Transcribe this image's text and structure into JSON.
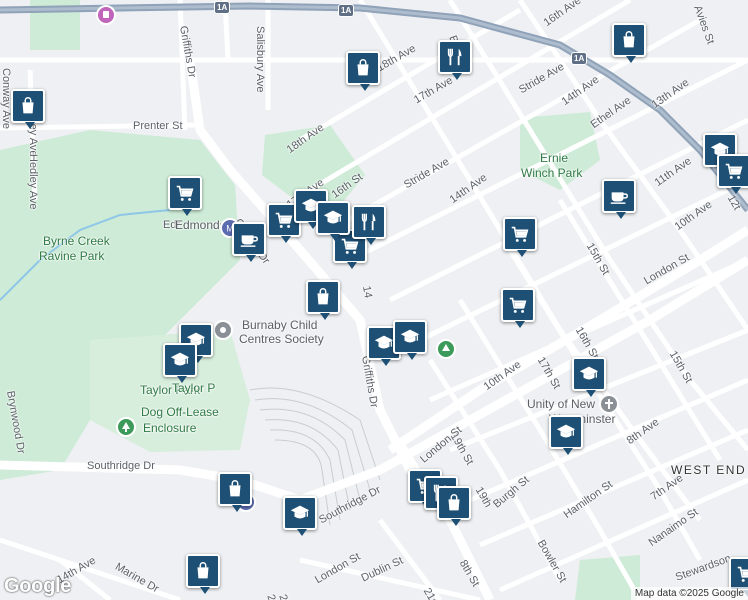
{
  "map": {
    "attribution": "Map data ©2025 Google",
    "logo": "Google",
    "colors": {
      "pin": "#1e4f74",
      "park": "#cdebd6",
      "highway": "#8fa2b8",
      "land": "#eef0f3"
    },
    "street_labels": [
      "Griffiths Dr",
      "Salisbury Ave",
      "Conway Ave",
      "Hedley Ave",
      "Hedley Ave",
      "Prenter St",
      "18th Ave",
      "17th Ave",
      "16th St",
      "17th Ave",
      "18th Ave",
      "Britton",
      "Stride Ave",
      "Stride Ave",
      "16th Ave",
      "14th Ave",
      "14th Ave",
      "13th Ave",
      "Ethel Ave",
      "11th Ave",
      "10th Ave",
      "10th Ave",
      "15th St",
      "16th St",
      "17th St",
      "London St",
      "15th St",
      "Griffiths Dr",
      "Griffiths Dr",
      "14",
      "Southridge Dr",
      "Southridge Dr",
      "19th St",
      "London St",
      "8th Ave",
      "Burgh St",
      "Hamilton St",
      "7th Ave",
      "Nanaimo St",
      "Bowler St",
      "8th St",
      "London St",
      "Dublin St",
      "21st",
      "Marine Dr",
      "14th Ave",
      "Edr",
      "Avies St",
      "Stewardson",
      "Brynwood Dr",
      "22",
      "23",
      "19th",
      "12t"
    ],
    "park_labels": [
      "Ernie",
      "Winch Park",
      "Byrne Creek",
      "Ravine Park",
      "Taylor Park",
      "Dog Off-Lease",
      "Enclosure",
      "Taylor P"
    ],
    "area_labels": [
      "WEST END"
    ],
    "poi_labels": [
      "Burnaby Child",
      "Centres Society",
      "Unity of New",
      "Westminster",
      "Edmonds"
    ],
    "highway_shields": [
      "1A",
      "1A",
      "1A"
    ],
    "pins": [
      {
        "icon": "shopping-bag"
      },
      {
        "icon": "restaurant"
      },
      {
        "icon": "shopping-bag"
      },
      {
        "icon": "shopping-bag"
      },
      {
        "icon": "shopping-cart"
      },
      {
        "icon": "shopping-cart"
      },
      {
        "icon": "school"
      },
      {
        "icon": "coffee-cup"
      },
      {
        "icon": "shopping-cart"
      },
      {
        "icon": "school"
      },
      {
        "icon": "restaurant"
      },
      {
        "icon": "shopping-cart"
      },
      {
        "icon": "coffee-cup"
      },
      {
        "icon": "shopping-cart"
      },
      {
        "icon": "shopping-bag"
      },
      {
        "icon": "school"
      },
      {
        "icon": "school"
      },
      {
        "icon": "school"
      },
      {
        "icon": "school"
      },
      {
        "icon": "school"
      },
      {
        "icon": "school"
      },
      {
        "icon": "school"
      },
      {
        "icon": "shopping-bag"
      },
      {
        "icon": "school"
      },
      {
        "icon": "shopping-cart"
      },
      {
        "icon": "shopping-cart"
      },
      {
        "icon": "restaurant"
      },
      {
        "icon": "shopping-bag"
      },
      {
        "icon": "shopping-bag"
      },
      {
        "icon": "shopping-cart"
      }
    ]
  }
}
